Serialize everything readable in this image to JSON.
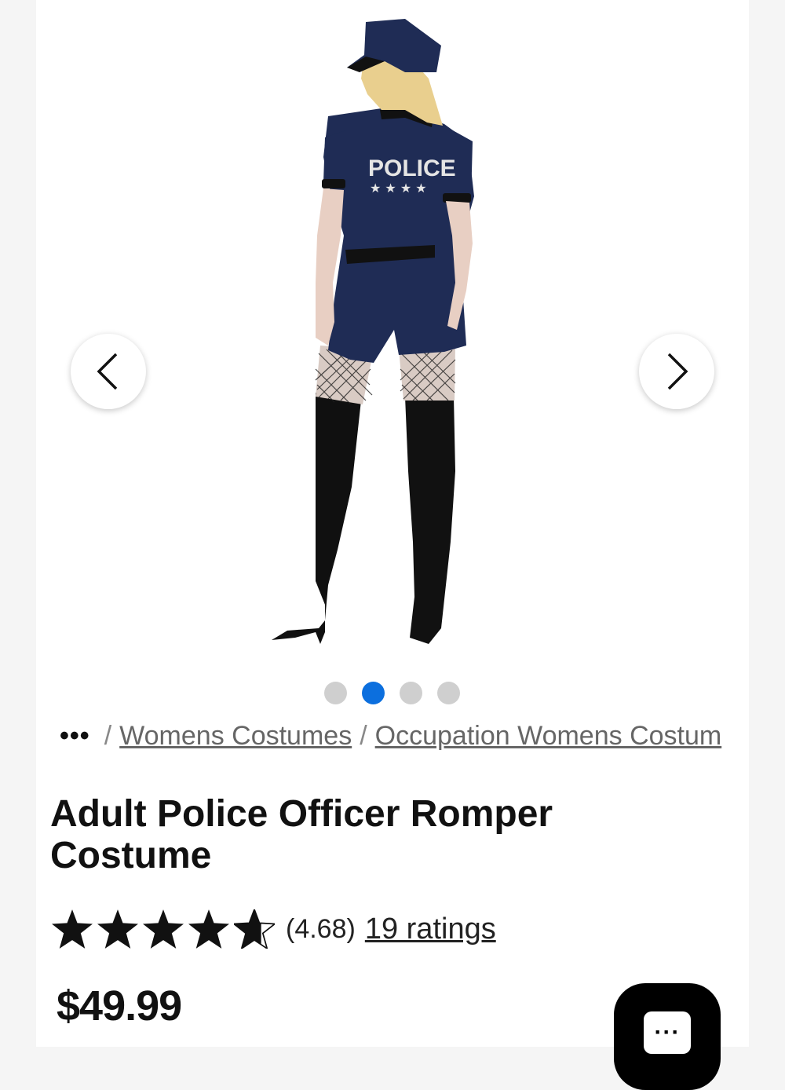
{
  "gallery": {
    "image_alt": "Adult Police Officer Romper Costume back view",
    "garment_text": "POLICE",
    "prev_icon": "chevron-left-icon",
    "next_icon": "chevron-right-icon",
    "slide_count": 4,
    "active_slide": 2
  },
  "breadcrumb": {
    "ellipsis": "•••",
    "separator": "/",
    "items": [
      "Womens Costumes",
      "Occupation Womens Costum"
    ]
  },
  "product": {
    "title_line1": "Adult Police Officer Romper",
    "title_line2": "Costume",
    "rating_value": "(4.68)",
    "rating_score": 4.68,
    "ratings_link": "19 ratings",
    "price": "$49.99"
  },
  "chat": {
    "icon": "chat-bubble-icon",
    "glyph": "···"
  },
  "colors": {
    "accent": "#0c6fde",
    "navy": "#1f2c55"
  }
}
